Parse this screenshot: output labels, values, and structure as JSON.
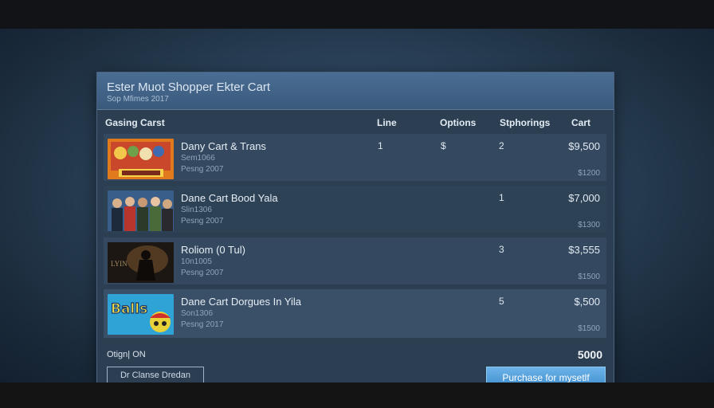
{
  "window": {
    "title": "Ester Muot Shopper Ekter Cart",
    "subtitle": "Sop Mfimes 2017"
  },
  "columns": {
    "name": "Gasing Carst",
    "line": "Line",
    "options": "Options",
    "shipping": "Stphorings",
    "cart": "Cart"
  },
  "items": [
    {
      "name": "Dany Cart & Trans",
      "sub1": "Sem1066",
      "sub2": "Pesng 2007",
      "line": "1",
      "options": "$",
      "shipping": "2",
      "cart": "$9,500",
      "cart_sub": "$1200",
      "thumb_icon": "comic-cover-thumbnail"
    },
    {
      "name": "Dane Cart Bood Yala",
      "sub1": "Slin1306",
      "sub2": "Pesng 2007",
      "line": "",
      "options": "",
      "shipping": "1",
      "cart": "$7,000",
      "cart_sub": "$1300",
      "thumb_icon": "group-portrait-thumbnail"
    },
    {
      "name": "Roliom (0 Tul)",
      "sub1": "10n1005",
      "sub2": "Pesng 2007",
      "line": "",
      "options": "",
      "shipping": "3",
      "cart": "$3,555",
      "cart_sub": "$1500",
      "thumb_icon": "dark-figure-thumbnail"
    },
    {
      "name": "Dane Cart Dorgues In Yila",
      "sub1": "Son1306",
      "sub2": "Pesng 2017",
      "line": "",
      "options": "",
      "shipping": "5",
      "cart": "$,500",
      "cart_sub": "$1500",
      "thumb_icon": "balls-cartoon-thumbnail"
    }
  ],
  "footer": {
    "total_label": "Otign| ON",
    "total_value": "5000",
    "secondary_button": "Dr Clanse Dredan",
    "primary_button": "Purchase for mysetlf"
  },
  "colors": {
    "accent_button": "#4a9ad8",
    "window_bg": "#2b3e52",
    "header_bg": "#4a6d93"
  }
}
